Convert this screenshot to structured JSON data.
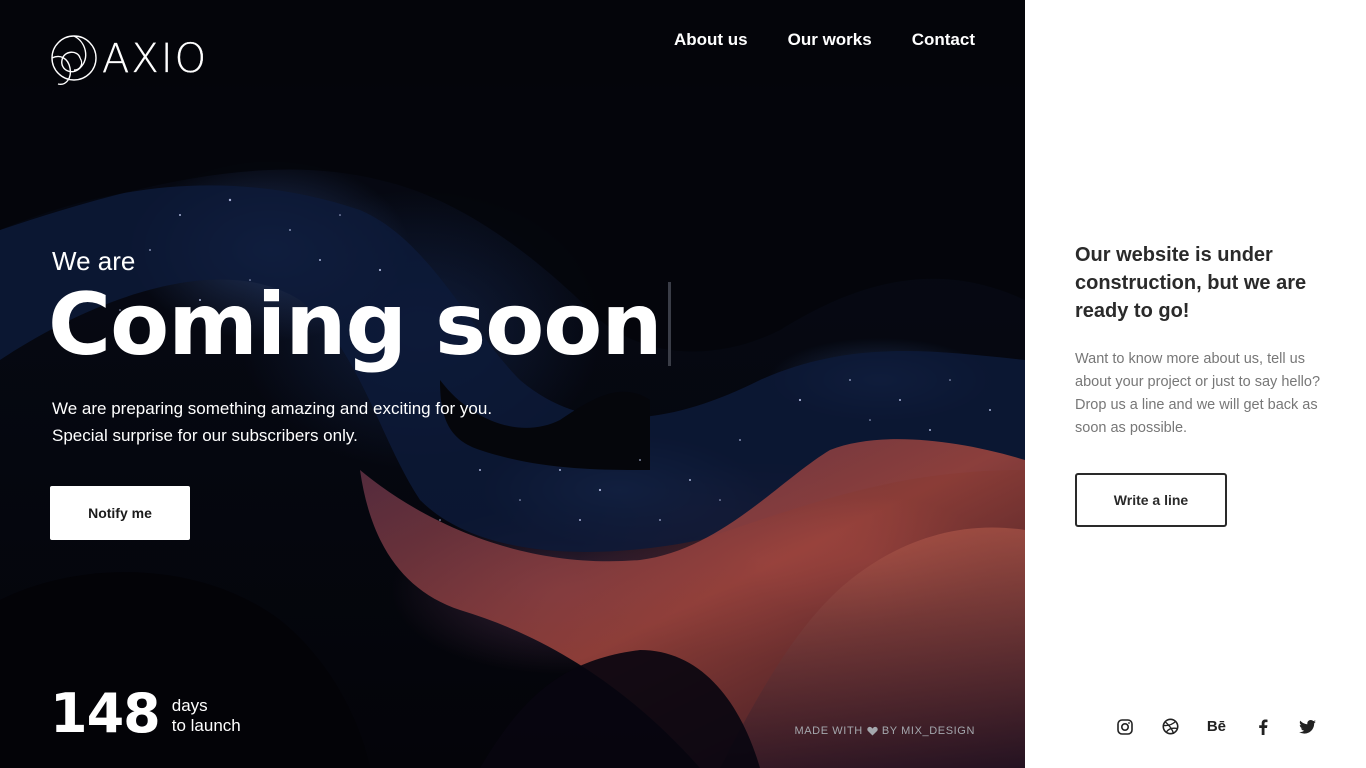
{
  "brand": {
    "name": "AXIO"
  },
  "nav": {
    "items": [
      "About us",
      "Our works",
      "Contact"
    ]
  },
  "hero": {
    "kicker": "We are",
    "headline": "Coming soon",
    "lead_line1": "We are preparing something amazing and exciting for you.",
    "lead_line2": "Special surprise for our subscribers only.",
    "notify_label": "Notify me"
  },
  "countdown": {
    "value": "148",
    "unit": "days",
    "caption": "to launch"
  },
  "footer": {
    "made_prefix": "MADE WITH",
    "made_suffix": "BY MIX_DESIGN"
  },
  "panel": {
    "title": "Our website is under construction, but we are ready to go!",
    "text": "Want to know more about us, tell us about your project or just to say hello? Drop us a line and we will get back as soon as possible.",
    "button_label": "Write a line"
  },
  "socials": {
    "behance_label": "Bē"
  },
  "colors": {
    "panel_bg": "#ffffff",
    "hero_bg": "#05070f",
    "accent_text": "#2a2a2a"
  }
}
